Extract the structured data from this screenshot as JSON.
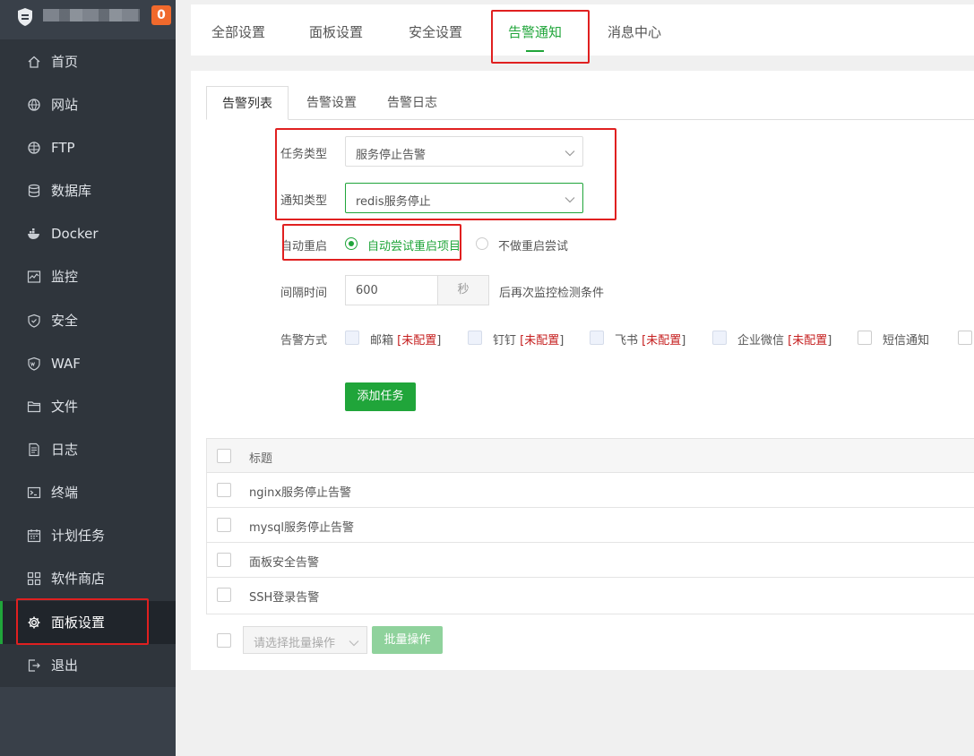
{
  "brand": {
    "badge": "0"
  },
  "sidebar": {
    "items": [
      {
        "label": "首页",
        "icon": "home-icon"
      },
      {
        "label": "网站",
        "icon": "globe-icon"
      },
      {
        "label": "FTP",
        "icon": "ftp-globe-icon"
      },
      {
        "label": "数据库",
        "icon": "database-icon"
      },
      {
        "label": "Docker",
        "icon": "docker-icon"
      },
      {
        "label": "监控",
        "icon": "monitor-icon"
      },
      {
        "label": "安全",
        "icon": "shield-icon"
      },
      {
        "label": "WAF",
        "icon": "waf-shield-icon"
      },
      {
        "label": "文件",
        "icon": "folder-icon"
      },
      {
        "label": "日志",
        "icon": "log-icon"
      },
      {
        "label": "终端",
        "icon": "terminal-icon"
      },
      {
        "label": "计划任务",
        "icon": "calendar-icon"
      },
      {
        "label": "软件商店",
        "icon": "apps-icon"
      },
      {
        "label": "面板设置",
        "icon": "gear-icon",
        "active": true
      },
      {
        "label": "退出",
        "icon": "logout-icon"
      }
    ]
  },
  "top_tabs": [
    {
      "label": "全部设置"
    },
    {
      "label": "面板设置"
    },
    {
      "label": "安全设置"
    },
    {
      "label": "告警通知",
      "active": true
    },
    {
      "label": "消息中心"
    }
  ],
  "sub_tabs": [
    {
      "label": "告警列表",
      "active": true
    },
    {
      "label": "告警设置"
    },
    {
      "label": "告警日志"
    }
  ],
  "form": {
    "task_type_label": "任务类型",
    "task_type_value": "服务停止告警",
    "notify_type_label": "通知类型",
    "notify_type_value": "redis服务停止",
    "auto_restart_label": "自动重启",
    "auto_restart_option_1": "自动尝试重启项目",
    "auto_restart_option_2": "不做重启尝试",
    "interval_label": "间隔时间",
    "interval_value": "600",
    "interval_unit": "秒",
    "interval_suffix": "后再次监控检测条件",
    "method_label": "告警方式",
    "methods": [
      {
        "name": "邮箱",
        "note": "未配置"
      },
      {
        "name": "钉钉",
        "note": "未配置"
      },
      {
        "name": "飞书",
        "note": "未配置"
      },
      {
        "name": "企业微信",
        "note": "未配置"
      },
      {
        "name": "短信通知",
        "note": ""
      }
    ],
    "unconfigured_open": "[",
    "unconfigured_close": "]",
    "add_button": "添加任务"
  },
  "table": {
    "header": "标题",
    "rows": [
      {
        "title": "nginx服务停止告警"
      },
      {
        "title": "mysql服务停止告警"
      },
      {
        "title": "面板安全告警"
      },
      {
        "title": "SSH登录告警"
      }
    ]
  },
  "batch": {
    "select_placeholder": "请选择批量操作",
    "button": "批量操作"
  },
  "colors": {
    "accent": "#20a53a",
    "sidebar_bg": "#2f353c",
    "badge": "#f0692c",
    "highlight": "#e02020",
    "warn_text": "#c51e1e"
  }
}
